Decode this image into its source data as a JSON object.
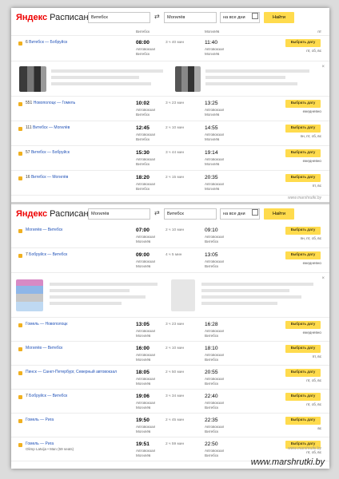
{
  "top": {
    "logo_brand": "Яндекс",
    "logo_title": "Расписания",
    "from": "Витебск",
    "to": "Могилёв",
    "date": "на все дни",
    "find": "Найти",
    "stub": {
      "dep_station": "Витебск",
      "arr_station": "Могилёв",
      "days": "пт"
    },
    "rows": [
      {
        "num": "6",
        "route": "Витебск — Бобруйск",
        "dep": "08:00",
        "dur": "3 ч 40 мин",
        "arr": "11:40",
        "dep_station_1": "Автовокзал",
        "dep_station_2": "Витебск",
        "arr_station_1": "Автовокзал",
        "arr_station_2": "Могилёв",
        "button": "Выбрать дату",
        "days": "пт, сб, вс"
      },
      {
        "num": "551",
        "route": "Новополоцк — Гомель",
        "dep": "10:02",
        "dur": "3 ч 23 мин",
        "arr": "13:25",
        "dep_station_1": "Автовокзал",
        "dep_station_2": "Витебск",
        "arr_station_1": "Автовокзал",
        "arr_station_2": "Могилёв",
        "button": "Выбрать дату",
        "days": "ежедневно"
      },
      {
        "num": "111",
        "route": "Витебск — Могилёв",
        "dep": "12:45",
        "dur": "2 ч 10 мин",
        "arr": "14:55",
        "dep_station_1": "Автовокзал",
        "dep_station_2": "Витебск",
        "arr_station_1": "Автовокзал",
        "arr_station_2": "Могилёв",
        "button": "Выбрать дату",
        "days": "пн, пт, сб, вс"
      },
      {
        "num": "57",
        "route": "Витебск — Бобруйск",
        "dep": "15:30",
        "dur": "3 ч 44 мин",
        "arr": "19:14",
        "dep_station_1": "Автовокзал",
        "dep_station_2": "Витебск",
        "arr_station_1": "Автовокзал",
        "arr_station_2": "Могилёв",
        "button": "Выбрать дату",
        "days": "ежедневно"
      },
      {
        "num": "16",
        "route": "Витебск — Могилёв",
        "dep": "18:20",
        "dur": "2 ч 15 мин",
        "arr": "20:35",
        "dep_station_1": "Автовокзал",
        "dep_station_2": "Витебск",
        "arr_station_1": "Автовокзал",
        "arr_station_2": "Могилёв",
        "button": "Выбрать дату",
        "days": "пт, вс"
      }
    ],
    "watermark": "www.marshrutki.by"
  },
  "bottom": {
    "logo_brand": "Яндекс",
    "logo_title": "Расписания",
    "from": "Могилёв",
    "to": "Витебск",
    "date": "на все дни",
    "find": "Найти",
    "rows": [
      {
        "num": "",
        "route": "Могилёв — Витебск",
        "dep": "07:00",
        "dur": "2 ч 10 мин",
        "arr": "09:10",
        "dep_station_1": "Автовокзал",
        "dep_station_2": "Могилёв",
        "arr_station_1": "Автовокзал",
        "arr_station_2": "Витебск",
        "button": "Выбрать дату",
        "days": "пн, пт, сб, вс"
      },
      {
        "num": "7",
        "route": "Бобруйск — Витебск",
        "dep": "09:00",
        "dur": "4 ч 5 мин",
        "arr": "13:05",
        "dep_station_1": "Автовокзал",
        "dep_station_2": "Могилёв",
        "arr_station_1": "Автовокзал",
        "arr_station_2": "Витебск",
        "button": "Выбрать дату",
        "days": "ежедневно"
      },
      {
        "num": "",
        "route": "Гомель — Новополоцк",
        "dep": "13:05",
        "dur": "3 ч 23 мин",
        "arr": "16:28",
        "dep_station_1": "Автовокзал",
        "dep_station_2": "Могилёв",
        "arr_station_1": "Автовокзал",
        "arr_station_2": "Витебск",
        "button": "Выбрать дату",
        "days": "ежедневно"
      },
      {
        "num": "",
        "route": "Могилёв — Витебск",
        "dep": "16:00",
        "dur": "2 ч 10 мин",
        "arr": "18:10",
        "dep_station_1": "Автовокзал",
        "dep_station_2": "Могилёв",
        "arr_station_1": "Автовокзал",
        "arr_station_2": "Витебск",
        "button": "Выбрать дату",
        "days": "пт, вс"
      },
      {
        "num": "",
        "route": "Пинск — Санкт-Петербург, Северный автовокзал",
        "dep": "18:05",
        "dur": "2 ч 50 мин",
        "arr": "20:55",
        "dep_station_1": "Автовокзал",
        "dep_station_2": "Могилёв",
        "arr_station_1": "Автовокзал",
        "arr_station_2": "Витебск",
        "button": "Выбрать дату",
        "days": "пт, сб, вс"
      },
      {
        "num": "7",
        "route": "Бобруйск — Витебск",
        "dep": "19:06",
        "dur": "3 ч 34 мин",
        "arr": "22:40",
        "dep_station_1": "Автовокзал",
        "dep_station_2": "Могилёв",
        "arr_station_1": "Автовокзал",
        "arr_station_2": "Витебск",
        "button": "Выбрать дату",
        "days": "пт, сб, вс"
      },
      {
        "num": "",
        "route": "Гомель — Рига",
        "dep": "19:50",
        "dur": "2 ч 45 мин",
        "arr": "22:35",
        "dep_station_1": "Автовокзал",
        "dep_station_2": "Могилёв",
        "arr_station_1": "Автовокзал",
        "arr_station_2": "Витебск",
        "button": "Выбрать дату",
        "days": "вс"
      },
      {
        "num": "",
        "route": "Гомель — Рига",
        "sub": "Olimp Latvija • Man (59 seats)",
        "dep": "19:51",
        "dur": "2 ч 59 мин",
        "arr": "22:50",
        "dep_station_1": "Автовокзал",
        "dep_station_2": "Могилёв",
        "arr_station_1": "Автовокзал",
        "arr_station_2": "Витебск",
        "button": "Выбрать дату",
        "days": "пт, сб, вс"
      }
    ],
    "watermark": "www.marshrutki.by"
  },
  "footer_watermark": "www.marshrutki.by"
}
